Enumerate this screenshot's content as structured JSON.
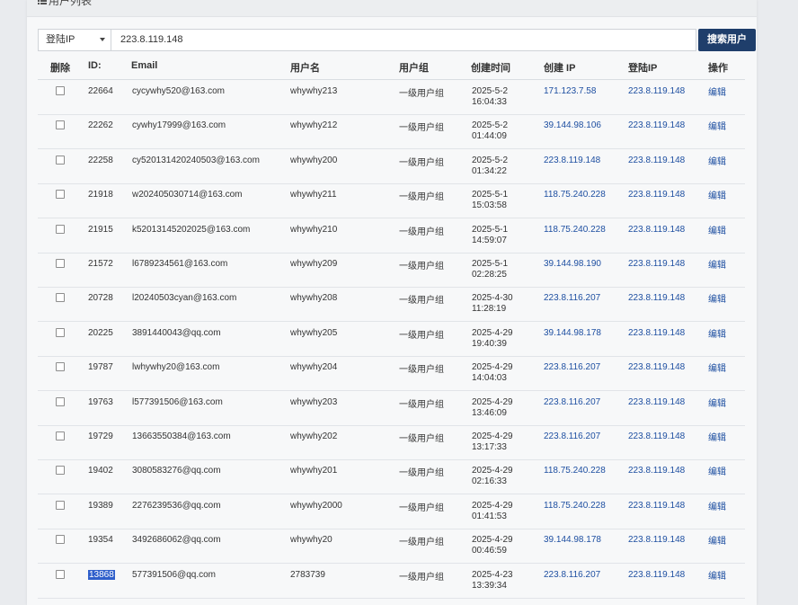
{
  "page_title": "用户列表",
  "search": {
    "field_select": "登陆IP",
    "query_value": "223.8.119.148",
    "button_label": "搜索用户"
  },
  "table": {
    "headers": [
      "删除",
      "ID:",
      "Email",
      "用户名",
      "用户组",
      "创建时间",
      "创建 IP",
      "登陆IP",
      "操作"
    ],
    "rows": [
      {
        "id": "22664",
        "email": "cycywhy520@163.com",
        "username": "whywhy213",
        "group": "一级用户组",
        "date": "2025-5-2",
        "time": "16:04:33",
        "create_ip": "171.123.7.58",
        "login_ip": "223.8.119.148",
        "action": "编辑"
      },
      {
        "id": "22262",
        "email": "cywhy17999@163.com",
        "username": "whywhy212",
        "group": "一级用户组",
        "date": "2025-5-2",
        "time": "01:44:09",
        "create_ip": "39.144.98.106",
        "login_ip": "223.8.119.148",
        "action": "编辑"
      },
      {
        "id": "22258",
        "email": "cy520131420240503@163.com",
        "username": "whywhy200",
        "group": "一级用户组",
        "date": "2025-5-2",
        "time": "01:34:22",
        "create_ip": "223.8.119.148",
        "login_ip": "223.8.119.148",
        "action": "编辑"
      },
      {
        "id": "21918",
        "email": "w202405030714@163.com",
        "username": "whywhy211",
        "group": "一级用户组",
        "date": "2025-5-1",
        "time": "15:03:58",
        "create_ip": "118.75.240.228",
        "login_ip": "223.8.119.148",
        "action": "编辑"
      },
      {
        "id": "21915",
        "email": "k52013145202025@163.com",
        "username": "whywhy210",
        "group": "一级用户组",
        "date": "2025-5-1",
        "time": "14:59:07",
        "create_ip": "118.75.240.228",
        "login_ip": "223.8.119.148",
        "action": "编辑"
      },
      {
        "id": "21572",
        "email": "l6789234561@163.com",
        "username": "whywhy209",
        "group": "一级用户组",
        "date": "2025-5-1",
        "time": "02:28:25",
        "create_ip": "39.144.98.190",
        "login_ip": "223.8.119.148",
        "action": "编辑"
      },
      {
        "id": "20728",
        "email": "l20240503cyan@163.com",
        "username": "whywhy208",
        "group": "一级用户组",
        "date": "2025-4-30",
        "time": "11:28:19",
        "create_ip": "223.8.116.207",
        "login_ip": "223.8.119.148",
        "action": "编辑"
      },
      {
        "id": "20225",
        "email": "3891440043@qq.com",
        "username": "whywhy205",
        "group": "一级用户组",
        "date": "2025-4-29",
        "time": "19:40:39",
        "create_ip": "39.144.98.178",
        "login_ip": "223.8.119.148",
        "action": "编辑"
      },
      {
        "id": "19787",
        "email": "lwhywhy20@163.com",
        "username": "whywhy204",
        "group": "一级用户组",
        "date": "2025-4-29",
        "time": "14:04:03",
        "create_ip": "223.8.116.207",
        "login_ip": "223.8.119.148",
        "action": "编辑"
      },
      {
        "id": "19763",
        "email": "l577391506@163.com",
        "username": "whywhy203",
        "group": "一级用户组",
        "date": "2025-4-29",
        "time": "13:46:09",
        "create_ip": "223.8.116.207",
        "login_ip": "223.8.119.148",
        "action": "编辑"
      },
      {
        "id": "19729",
        "email": "13663550384@163.com",
        "username": "whywhy202",
        "group": "一级用户组",
        "date": "2025-4-29",
        "time": "13:17:33",
        "create_ip": "223.8.116.207",
        "login_ip": "223.8.119.148",
        "action": "编辑"
      },
      {
        "id": "19402",
        "email": "3080583276@qq.com",
        "username": "whywhy201",
        "group": "一级用户组",
        "date": "2025-4-29",
        "time": "02:16:33",
        "create_ip": "118.75.240.228",
        "login_ip": "223.8.119.148",
        "action": "编辑"
      },
      {
        "id": "19389",
        "email": "2276239536@qq.com",
        "username": "whywhy2000",
        "group": "一级用户组",
        "date": "2025-4-29",
        "time": "01:41:53",
        "create_ip": "118.75.240.228",
        "login_ip": "223.8.119.148",
        "action": "编辑"
      },
      {
        "id": "19354",
        "email": "3492686062@qq.com",
        "username": "whywhy20",
        "group": "一级用户组",
        "date": "2025-4-29",
        "time": "00:46:59",
        "create_ip": "39.144.98.178",
        "login_ip": "223.8.119.148",
        "action": "编辑"
      },
      {
        "id": "13868",
        "email": "577391506@qq.com",
        "username": "2783739",
        "group": "一级用户组",
        "date": "2025-4-23",
        "time": "13:39:34",
        "create_ip": "223.8.116.207",
        "login_ip": "223.8.119.148",
        "action": "编辑",
        "selected": true
      }
    ]
  },
  "colors": {
    "accent_button": "#1f3e6b",
    "link": "#1e4fa1",
    "selection": "#2f5fcb"
  },
  "icons": {
    "title_icon": "list-icon",
    "select_icon": "chevron-down-icon"
  }
}
